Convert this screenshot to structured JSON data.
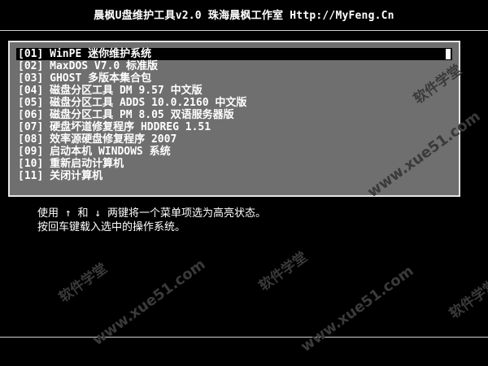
{
  "header": {
    "title": "晨枫U盘维护工具v2.0  珠海晨枫工作室 Http://MyFeng.Cn"
  },
  "menu": {
    "selected_index": 0,
    "items": [
      {
        "label": "[01] WinPE 迷你维护系统"
      },
      {
        "label": "[02] MaxDOS V7.0 标准版"
      },
      {
        "label": "[03] GHOST 多版本集合包"
      },
      {
        "label": "[04] 磁盘分区工具 DM 9.57 中文版"
      },
      {
        "label": "[05] 磁盘分区工具 ADDS 10.0.2160 中文版"
      },
      {
        "label": "[06] 磁盘分区工具 PM 8.05 双语服务器版"
      },
      {
        "label": "[07] 硬盘坏道修复程序 HDDREG 1.51"
      },
      {
        "label": "[08] 效率源硬盘修复程序 2007"
      },
      {
        "label": "[09] 启动本机 WINDOWS 系统"
      },
      {
        "label": "[10] 重新启动计算机"
      },
      {
        "label": "[11] 关闭计算机"
      }
    ]
  },
  "help": {
    "line1": "使用 ↑ 和 ↓ 两键将一个菜单项选为高亮状态。",
    "line2": "按回车键载入选中的操作系统。"
  },
  "watermarks": {
    "site_cn": "软件学堂",
    "site_url": "www.xue51.com"
  },
  "colors": {
    "background": "#000000",
    "menu_panel": "#6f6f6f",
    "highlight": "#000000",
    "text": "#ffffff"
  }
}
